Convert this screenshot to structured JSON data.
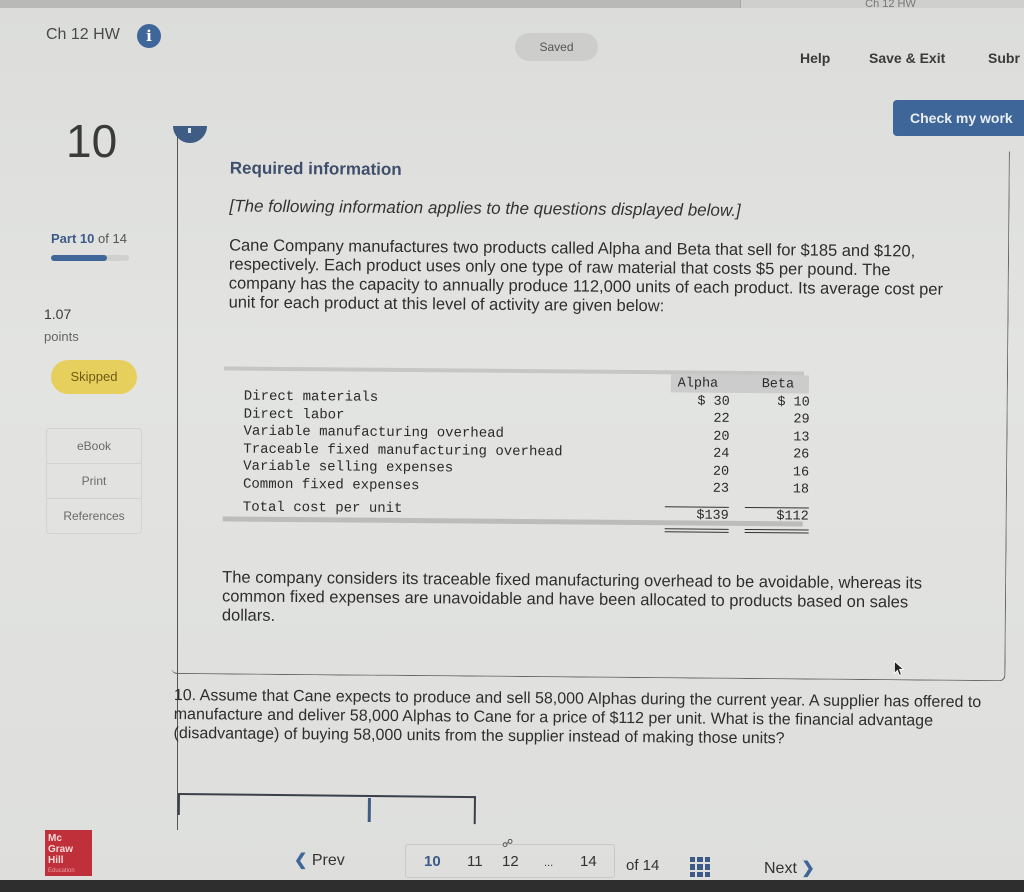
{
  "browser": {
    "tab_title": "Ch 12 HW"
  },
  "header": {
    "assignment_title": "Ch 12 HW",
    "info_icon": "i",
    "saved_status": "Saved",
    "help_label": "Help",
    "save_exit_label": "Save & Exit",
    "submit_label": "Subr",
    "check_my_work_label": "Check my work"
  },
  "sidebar": {
    "question_number": "10",
    "part_prefix": "Part",
    "part_current": "10",
    "part_suffix": "of 14",
    "progress_fraction": 0.714,
    "points_value": "1.07",
    "points_label": "points",
    "status_badge": "Skipped",
    "resources": [
      {
        "label": "eBook"
      },
      {
        "label": "Print"
      },
      {
        "label": "References"
      }
    ]
  },
  "info": {
    "title": "Required information",
    "subtitle": "[The following information applies to the questions displayed below.]",
    "paragraph": "Cane Company manufactures two products called Alpha and Beta that sell for $185 and $120, respectively. Each product uses only one type of raw material that costs $5 per pound. The company has the capacity to annually produce 112,000 units of each product. Its average cost per unit for each product at this level of activity are given below:",
    "table": {
      "columns": [
        "Alpha",
        "Beta"
      ],
      "rows": [
        {
          "label": "Direct materials",
          "alpha": "$ 30",
          "beta": "$ 10"
        },
        {
          "label": "Direct labor",
          "alpha": "22",
          "beta": "29"
        },
        {
          "label": "Variable manufacturing overhead",
          "alpha": "20",
          "beta": "13"
        },
        {
          "label": "Traceable fixed manufacturing overhead",
          "alpha": "24",
          "beta": "26"
        },
        {
          "label": "Variable selling expenses",
          "alpha": "20",
          "beta": "16"
        },
        {
          "label": "Common fixed expenses",
          "alpha": "23",
          "beta": "18"
        }
      ],
      "total": {
        "label": "Total cost per unit",
        "alpha": "$139",
        "beta": "$112"
      }
    },
    "paragraph2": "The company considers its traceable fixed manufacturing overhead to be avoidable, whereas its common fixed expenses are unavoidable and have been allocated to products based on sales dollars."
  },
  "question": {
    "text": "10. Assume that Cane expects to produce and sell 58,000 Alphas during the current year. A supplier has offered to manufacture and deliver 58,000 Alphas to Cane for a price of $112 per unit. What is the financial advantage (disadvantage) of buying 58,000 units from the supplier instead of making those units?"
  },
  "footer": {
    "logo_lines": [
      "Mc",
      "Graw",
      "Hill",
      "Education"
    ],
    "prev_label": "Prev",
    "pages": [
      "10",
      "11",
      "12",
      "...",
      "14"
    ],
    "current_page": "10",
    "of_label": "of 14",
    "next_label": "Next"
  }
}
